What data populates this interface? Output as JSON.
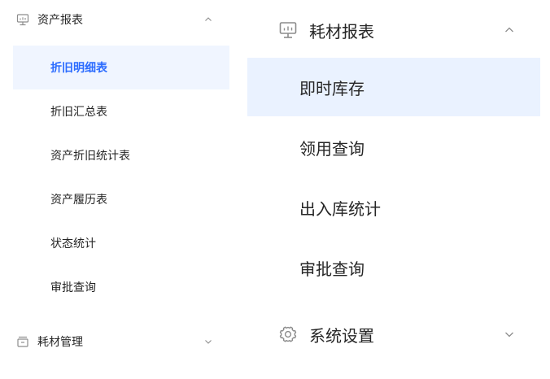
{
  "colors": {
    "accent": "#2b6bff",
    "active_bg_left": "#f0f5ff",
    "active_bg_right": "#eaf2ff",
    "text": "#262626",
    "icon_gray": "#8c8c8c"
  },
  "left_menu": {
    "group_asset_reports": {
      "label": "资产报表",
      "icon": "report-icon",
      "state": "expanded"
    },
    "items": [
      {
        "label": "折旧明细表",
        "active": true
      },
      {
        "label": "折旧汇总表",
        "active": false
      },
      {
        "label": "资产折旧统计表",
        "active": false
      },
      {
        "label": "资产履历表",
        "active": false
      },
      {
        "label": "状态统计",
        "active": false
      },
      {
        "label": "审批查询",
        "active": false
      }
    ],
    "group_consumables_mgmt": {
      "label": "耗材管理",
      "icon": "box-icon",
      "state": "collapsed"
    }
  },
  "right_menu": {
    "group_consumables_reports": {
      "label": "耗材报表",
      "icon": "report-icon",
      "state": "expanded"
    },
    "items": [
      {
        "label": "即时库存",
        "active": true
      },
      {
        "label": "领用查询",
        "active": false
      },
      {
        "label": "出入库统计",
        "active": false
      },
      {
        "label": "审批查询",
        "active": false
      }
    ],
    "group_system_settings": {
      "label": "系统设置",
      "icon": "gear-icon",
      "state": "collapsed"
    }
  }
}
